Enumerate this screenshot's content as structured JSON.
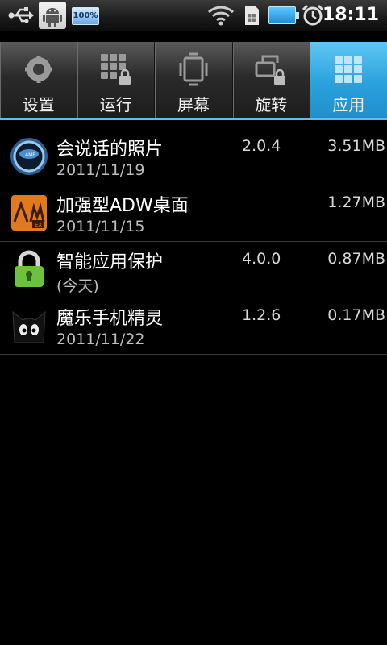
{
  "status_bar": {
    "time": "18:11",
    "battery_label": "100%",
    "icons": [
      "usb-icon",
      "android-debug-icon",
      "battery-full-icon",
      "wifi-icon",
      "sim-icon",
      "battery-icon",
      "alarm-icon"
    ]
  },
  "tabs": [
    {
      "label": "设置",
      "icon": "settings-gear-icon"
    },
    {
      "label": "运行",
      "icon": "running-grid-lock-icon"
    },
    {
      "label": "屏幕",
      "icon": "screen-rotate-icon"
    },
    {
      "label": "旋转",
      "icon": "rotation-lock-icon"
    },
    {
      "label": "应用",
      "icon": "apps-grid-icon"
    }
  ],
  "active_tab": "应用",
  "apps": [
    {
      "name": "会说话的照片",
      "date": "2011/11/19",
      "version": "2.0.4",
      "size": "3.51MB",
      "icon": "talking-photo-icon"
    },
    {
      "name": "加强型ADW桌面",
      "date": "2011/11/15",
      "version": "",
      "size": "1.27MB",
      "icon": "adw-launcher-icon"
    },
    {
      "name": "智能应用保护",
      "date": "(今天)",
      "version": "4.0.0",
      "size": "0.87MB",
      "icon": "padlock-icon"
    },
    {
      "name": "魔乐手机精灵",
      "date": "2011/11/22",
      "version": "1.2.6",
      "size": "0.17MB",
      "icon": "cat-icon"
    }
  ],
  "colors": {
    "accent": "#2aa1dc",
    "background": "#000000",
    "divider": "#3a3a3a"
  }
}
